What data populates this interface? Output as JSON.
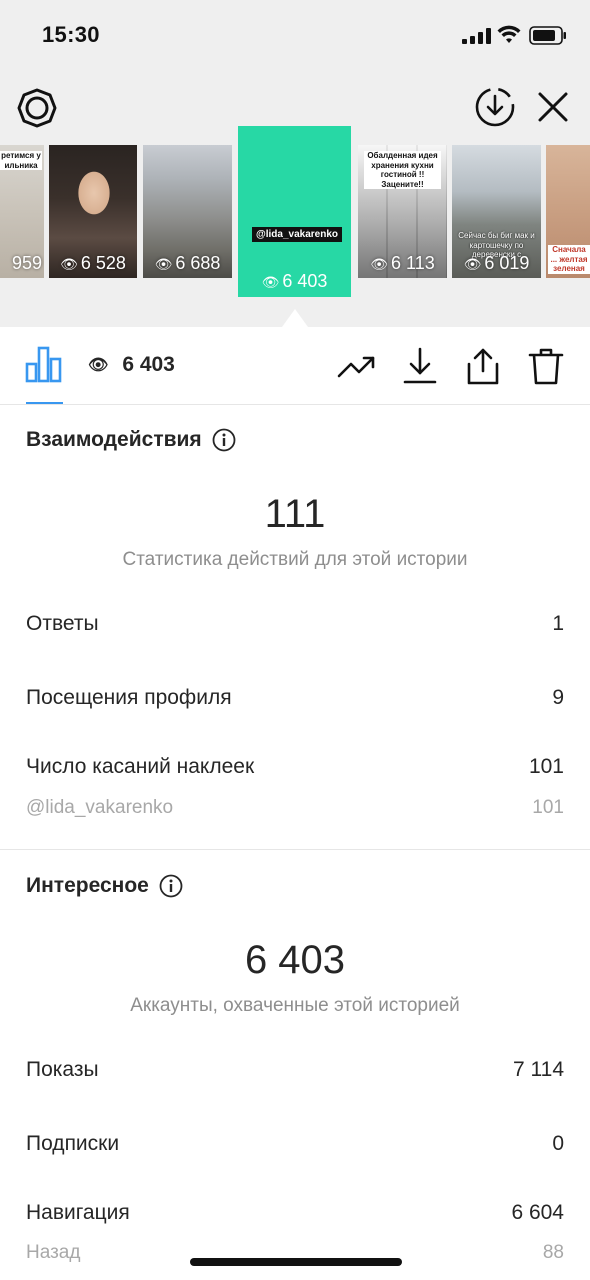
{
  "status_bar": {
    "time": "15:30",
    "icons": [
      "signal-icon",
      "wifi-icon",
      "battery-icon"
    ]
  },
  "header": {
    "left_icon": "settings-icon",
    "right_icons": [
      "download-circle-icon",
      "close-icon"
    ]
  },
  "thumbnails": [
    {
      "caption": "ретимся у ильника",
      "views": "959"
    },
    {
      "caption": "",
      "views": "6 528"
    },
    {
      "caption": "",
      "views": "6 688"
    },
    {
      "caption": "@lida_vakarenko",
      "views": "6 403",
      "active": true
    },
    {
      "caption": "Обалденная идея хранения кухни гостиной !! Зацените!!",
      "views": "6 113"
    },
    {
      "caption": "Сейчас бы биг мак и картошечку по деревенски с",
      "views": "6 019"
    },
    {
      "caption": "Сначала ... желтая зеленая",
      "views": ""
    }
  ],
  "toolbar": {
    "views": "6 403",
    "icons": [
      "bar-chart-icon",
      "eye-icon",
      "trending-icon",
      "download-icon",
      "share-icon",
      "trash-icon"
    ]
  },
  "interactions": {
    "title": "Взаимодействия",
    "total": "111",
    "subtitle": "Статистика действий для этой истории",
    "rows": [
      {
        "label": "Ответы",
        "value": "1"
      },
      {
        "label": "Посещения профиля",
        "value": "9"
      },
      {
        "label": "Число касаний наклеек",
        "value": "101"
      }
    ],
    "sub_row": {
      "label": "@lida_vakarenko",
      "value": "101"
    }
  },
  "discovery": {
    "title": "Интересное",
    "total": "6 403",
    "subtitle": "Аккаунты, охваченные этой историей",
    "rows": [
      {
        "label": "Показы",
        "value": "7 114"
      },
      {
        "label": "Подписки",
        "value": "0"
      },
      {
        "label": "Навигация",
        "value": "6 604"
      }
    ],
    "sub_row": {
      "label": "Назад",
      "value": "88"
    }
  },
  "colors": {
    "accent": "#3897f0",
    "active_thumb": "#27d8a5",
    "text": "#262626",
    "muted": "#8e8e8e",
    "background_top": "#efefef"
  }
}
